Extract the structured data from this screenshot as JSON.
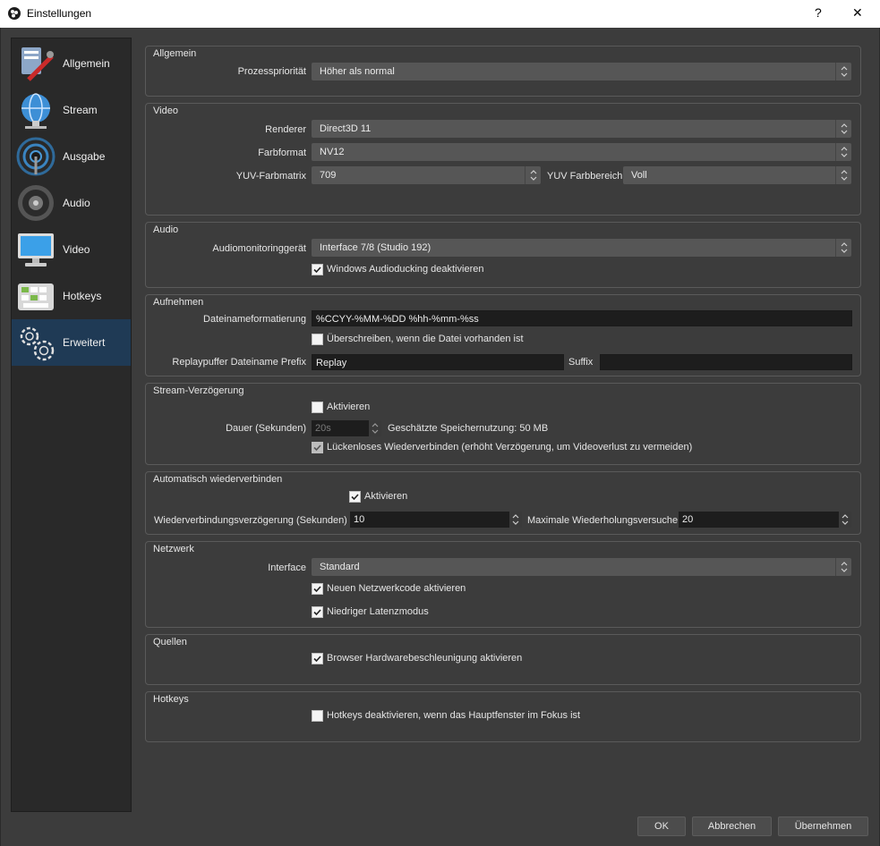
{
  "window": {
    "title": "Einstellungen",
    "help_label": "?",
    "close_label": "✕"
  },
  "sidebar": {
    "items": [
      {
        "label": "Allgemein",
        "icon": "tools-icon"
      },
      {
        "label": "Stream",
        "icon": "globe-icon"
      },
      {
        "label": "Ausgabe",
        "icon": "broadcast-icon"
      },
      {
        "label": "Audio",
        "icon": "speaker-icon"
      },
      {
        "label": "Video",
        "icon": "monitor-icon"
      },
      {
        "label": "Hotkeys",
        "icon": "keyboard-icon"
      },
      {
        "label": "Erweitert",
        "icon": "gears-icon",
        "active": true
      }
    ]
  },
  "groups": {
    "allgemein": {
      "title": "Allgemein",
      "priority_label": "Prozesspriorität",
      "priority_value": "Höher als normal"
    },
    "video": {
      "title": "Video",
      "renderer_label": "Renderer",
      "renderer_value": "Direct3D 11",
      "format_label": "Farbformat",
      "format_value": "NV12",
      "matrix_label": "YUV-Farbmatrix",
      "matrix_value": "709",
      "range_label": "YUV Farbbereich",
      "range_value": "Voll"
    },
    "audio": {
      "title": "Audio",
      "monitor_label": "Audiomonitoringgerät",
      "monitor_value": "Interface 7/8 (Studio 192)",
      "ducking_label": "Windows Audioducking deaktivieren",
      "ducking_checked": true
    },
    "aufnehmen": {
      "title": "Aufnehmen",
      "filename_label": "Dateinameformatierung",
      "filename_value": "%CCYY-%MM-%DD %hh-%mm-%ss",
      "overwrite_label": "Überschreiben, wenn die Datei vorhanden ist",
      "overwrite_checked": false,
      "replay_prefix_label": "Replaypuffer Dateiname Prefix",
      "replay_prefix_value": "Replay",
      "suffix_label": "Suffix",
      "suffix_value": ""
    },
    "delay": {
      "title": "Stream-Verzögerung",
      "enable_label": "Aktivieren",
      "enable_checked": false,
      "duration_label": "Dauer (Sekunden)",
      "duration_value": "20s",
      "memory_label": "Geschätzte Speichernutzung: 50 MB",
      "preserve_label": "Lückenloses Wiederverbinden (erhöht Verzögerung, um Videoverlust zu vermeiden)",
      "preserve_checked": true
    },
    "reconnect": {
      "title": "Automatisch wiederverbinden",
      "enable_label": "Aktivieren",
      "enable_checked": true,
      "delay_label": "Wiederverbindungsverzögerung (Sekunden)",
      "delay_value": "10",
      "retries_label": "Maximale Wiederholungsversuche",
      "retries_value": "20"
    },
    "network": {
      "title": "Netzwerk",
      "interface_label": "Interface",
      "interface_value": "Standard",
      "newcode_label": "Neuen Netzwerkcode aktivieren",
      "newcode_checked": true,
      "lowlatency_label": "Niedriger Latenzmodus",
      "lowlatency_checked": true
    },
    "sources": {
      "title": "Quellen",
      "browser_accel_label": "Browser Hardwarebeschleunigung aktivieren",
      "browser_accel_checked": true
    },
    "hotkeys": {
      "title": "Hotkeys",
      "disable_label": "Hotkeys deaktivieren, wenn das Hauptfenster im Fokus ist",
      "disable_checked": false
    }
  },
  "footer": {
    "ok_label": "OK",
    "cancel_label": "Abbrechen",
    "apply_label": "Übernehmen"
  }
}
